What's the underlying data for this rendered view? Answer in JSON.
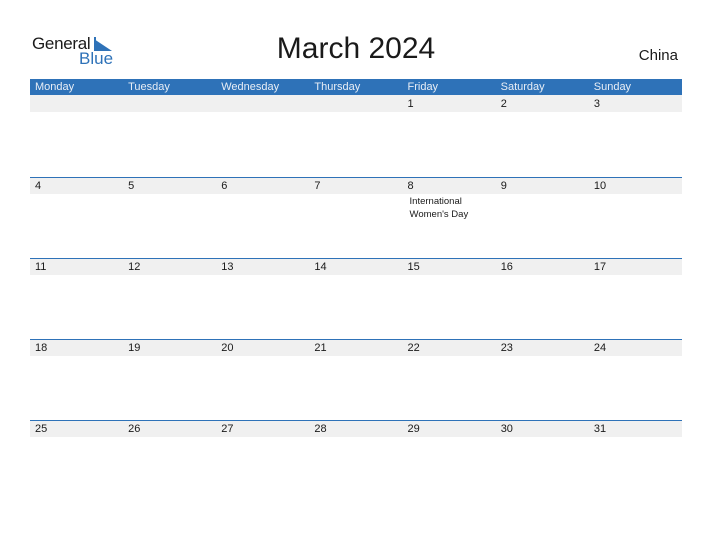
{
  "logo": {
    "word1": "General",
    "word2": "Blue"
  },
  "title": "March 2024",
  "country": "China",
  "colors": {
    "accent": "#2e72b8",
    "band": "#f0f0f0"
  },
  "weekdays": [
    "Monday",
    "Tuesday",
    "Wednesday",
    "Thursday",
    "Friday",
    "Saturday",
    "Sunday"
  ],
  "weeks": [
    [
      {
        "day": ""
      },
      {
        "day": ""
      },
      {
        "day": ""
      },
      {
        "day": ""
      },
      {
        "day": "1"
      },
      {
        "day": "2"
      },
      {
        "day": "3"
      }
    ],
    [
      {
        "day": "4"
      },
      {
        "day": "5"
      },
      {
        "day": "6"
      },
      {
        "day": "7"
      },
      {
        "day": "8",
        "event": "International Women's Day"
      },
      {
        "day": "9"
      },
      {
        "day": "10"
      }
    ],
    [
      {
        "day": "11"
      },
      {
        "day": "12"
      },
      {
        "day": "13"
      },
      {
        "day": "14"
      },
      {
        "day": "15"
      },
      {
        "day": "16"
      },
      {
        "day": "17"
      }
    ],
    [
      {
        "day": "18"
      },
      {
        "day": "19"
      },
      {
        "day": "20"
      },
      {
        "day": "21"
      },
      {
        "day": "22"
      },
      {
        "day": "23"
      },
      {
        "day": "24"
      }
    ],
    [
      {
        "day": "25"
      },
      {
        "day": "26"
      },
      {
        "day": "27"
      },
      {
        "day": "28"
      },
      {
        "day": "29"
      },
      {
        "day": "30"
      },
      {
        "day": "31"
      }
    ]
  ]
}
